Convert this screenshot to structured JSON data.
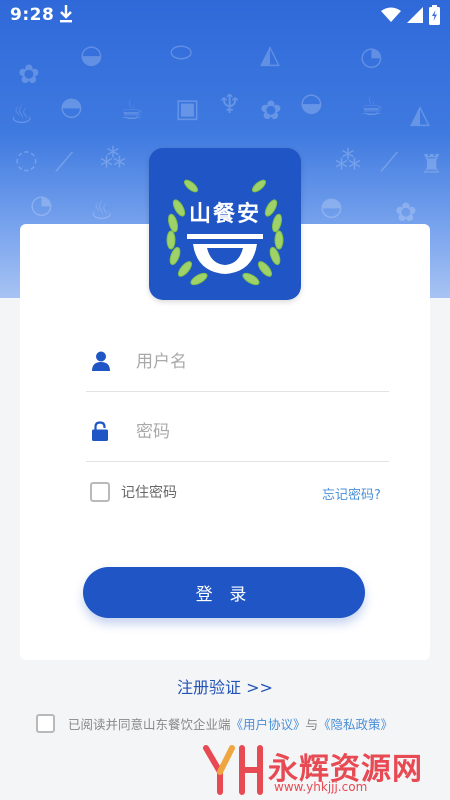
{
  "status_bar": {
    "time": "9:28",
    "download_icon": "download-icon",
    "wifi_icon": "wifi-icon",
    "signal_icon": "signal-icon",
    "battery_icon": "battery-charging-icon"
  },
  "logo": {
    "title": "山餐安",
    "brand_color": "#1f55c4"
  },
  "form": {
    "username_placeholder": "用户名",
    "password_placeholder": "密码",
    "remember_label": "记住密码",
    "remember_checked": false,
    "forgot_label": "忘记密码?",
    "login_label": "登 录"
  },
  "register_link": "注册验证 >>",
  "agreement": {
    "checked": false,
    "prefix": "已阅读并同意山东餐饮企业端",
    "user_agreement": "《用户协议》",
    "conjunction": "与",
    "privacy_policy": "《隐私政策》"
  },
  "watermark": {
    "text": "永辉资源网",
    "url": "www.yhkjjj.com"
  },
  "colors": {
    "primary": "#1f55c4",
    "link": "#4a8fd8",
    "header_top": "#2f69d9",
    "watermark": "#e84a53"
  }
}
